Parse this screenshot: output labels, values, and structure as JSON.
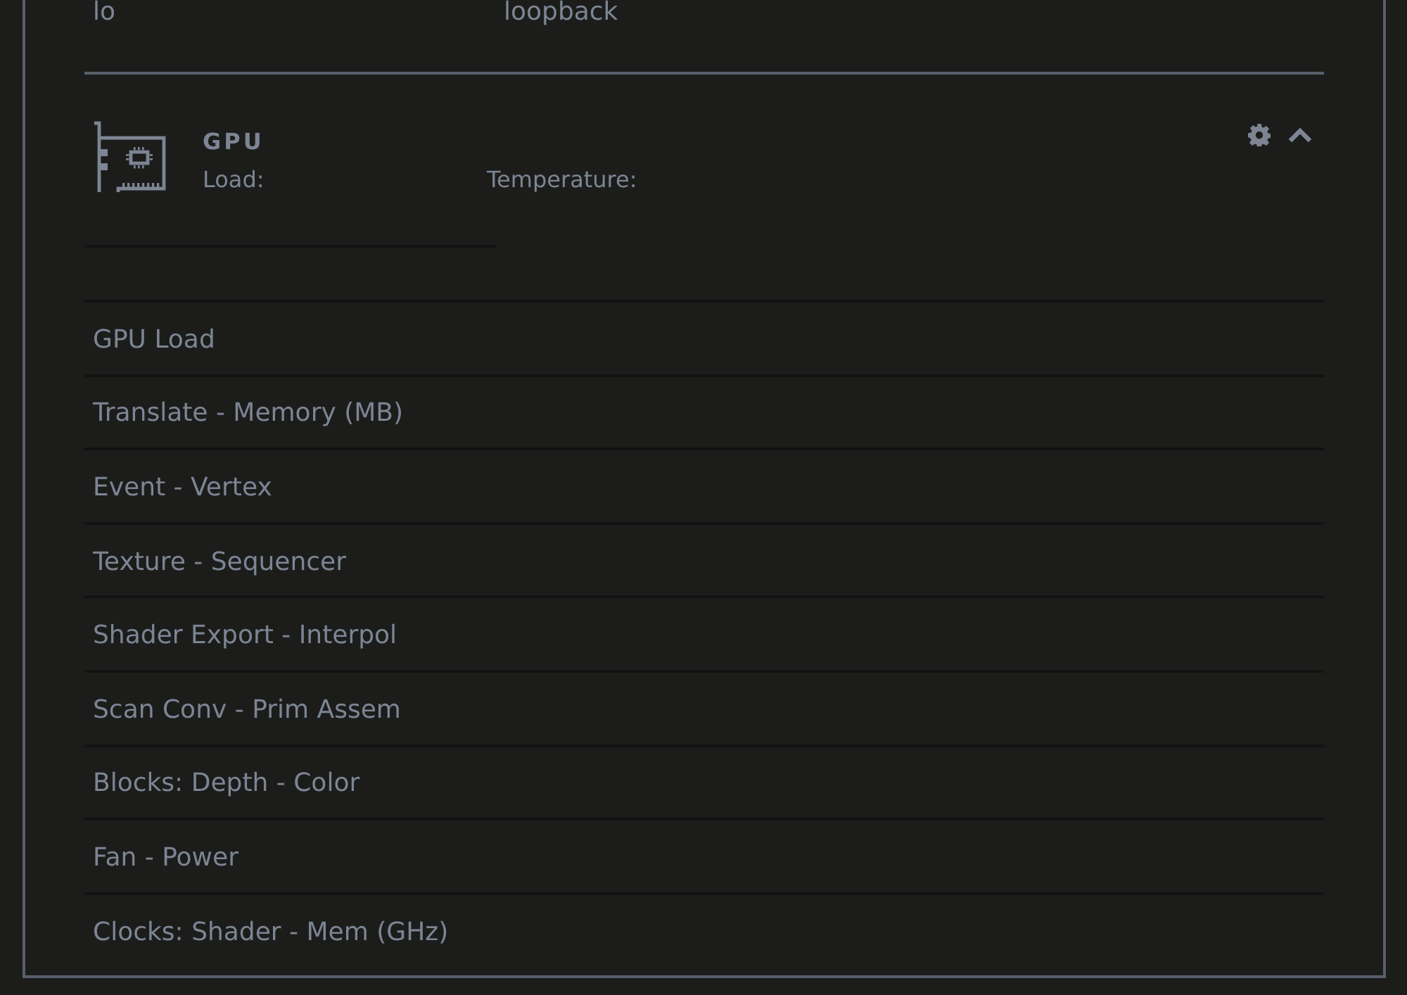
{
  "top_row": {
    "column_1": "lo",
    "column_2": "loopback"
  },
  "gpu": {
    "title": "GPU",
    "load_label": "Load:",
    "temperature_label": "Temperature:",
    "expanded": true
  },
  "metrics": [
    {
      "label": "GPU Load"
    },
    {
      "label": "Translate - Memory (MB)"
    },
    {
      "label": "Event - Vertex"
    },
    {
      "label": "Texture - Sequencer"
    },
    {
      "label": "Shader Export - Interpol"
    },
    {
      "label": "Scan Conv - Prim Assem"
    },
    {
      "label": "Blocks: Depth - Color"
    },
    {
      "label": "Fan - Power"
    },
    {
      "label": "Clocks: Shader - Mem (GHz)"
    }
  ]
}
